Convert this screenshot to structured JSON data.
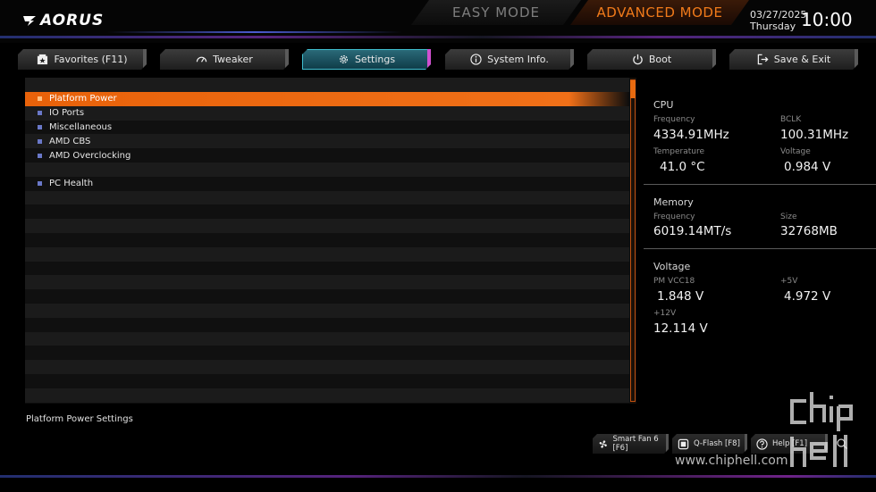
{
  "header": {
    "brand": "AORUS",
    "easy_mode": "EASY MODE",
    "advanced_mode": "ADVANCED MODE",
    "date": "03/27/2025",
    "day": "Thursday",
    "time": "10:00"
  },
  "tabs": [
    {
      "label": "Favorites (F11)",
      "icon": "favorites-icon",
      "active": false
    },
    {
      "label": "Tweaker",
      "icon": "speedometer-icon",
      "active": false
    },
    {
      "label": "Settings",
      "icon": "gear-icon",
      "active": true
    },
    {
      "label": "System Info.",
      "icon": "info-icon",
      "active": false
    },
    {
      "label": "Boot",
      "icon": "power-icon",
      "active": false
    },
    {
      "label": "Save & Exit",
      "icon": "exit-icon",
      "active": false
    }
  ],
  "menu_items": [
    "Platform Power",
    "IO Ports",
    "Miscellaneous",
    "AMD CBS",
    "AMD Overclocking",
    "",
    "PC Health"
  ],
  "selected_item": "Platform Power",
  "description": "Platform Power Settings",
  "cpu": {
    "title": "CPU",
    "frequency_label": "Frequency",
    "frequency": "4334.91MHz",
    "bclk_label": "BCLK",
    "bclk": "100.31MHz",
    "temperature_label": "Temperature",
    "temperature": "41.0 °C",
    "voltage_label": "Voltage",
    "voltage": "0.984 V"
  },
  "memory": {
    "title": "Memory",
    "frequency_label": "Frequency",
    "frequency": "6019.14MT/s",
    "size_label": "Size",
    "size": "32768MB"
  },
  "voltage": {
    "title": "Voltage",
    "pm_vcc18_label": "PM VCC18",
    "pm_vcc18": "1.848 V",
    "plus5v_label": "+5V",
    "plus5v": "4.972 V",
    "plus12v_label": "+12V",
    "plus12v": "12.114 V"
  },
  "footer": {
    "smart_fan": "Smart Fan 6 [F6]",
    "qflash": "Q-Flash [F8]",
    "help": "Help [F1]"
  },
  "watermark": {
    "url": "www.chiphell.com",
    "logo": "chip hell"
  },
  "colors": {
    "accent_orange": "#f07018",
    "active_tab": "#2b6b7a",
    "bullet": "#6a78c8"
  }
}
